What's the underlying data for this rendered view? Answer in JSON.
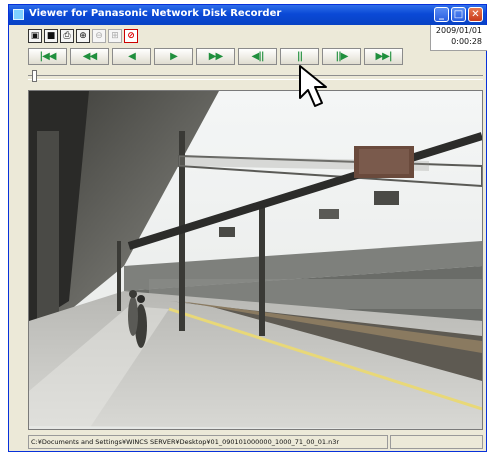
{
  "window": {
    "title": "Viewer for Panasonic Network Disk Recorder",
    "icon": "app-icon",
    "controls": [
      "minimize-icon",
      "maximize-icon",
      "close-icon"
    ]
  },
  "toolbar": {
    "tools": [
      "save-snapshot-icon",
      "save-icon",
      "print-icon",
      "zoom-in-icon",
      "zoom-out-icon",
      "multi-screen-icon",
      "stop-icon"
    ]
  },
  "datetime": {
    "date": "2009/01/01",
    "time": "0:00:28"
  },
  "playback": {
    "buttons": [
      {
        "name": "skip-to-start-button",
        "glyph": "|◀◀"
      },
      {
        "name": "fast-reverse-button",
        "glyph": "◀◀"
      },
      {
        "name": "reverse-play-button",
        "glyph": "◀"
      },
      {
        "name": "play-button",
        "glyph": "▶"
      },
      {
        "name": "fast-forward-button",
        "glyph": "▶▶"
      },
      {
        "name": "frame-back-button",
        "glyph": "◀||"
      },
      {
        "name": "pause-button",
        "glyph": "||"
      },
      {
        "name": "frame-forward-button",
        "glyph": "||▶"
      },
      {
        "name": "skip-to-end-button",
        "glyph": "▶▶|"
      }
    ]
  },
  "status": {
    "path": "C:¥Documents and Settings¥WINCS SERVER¥Desktop¥01_090101000000_1000_71_00_01.n3r"
  },
  "colors": {
    "titlebar": "#0a49d6",
    "playback_glyph": "#1f8f3c",
    "window_bg": "#ece9d8"
  }
}
